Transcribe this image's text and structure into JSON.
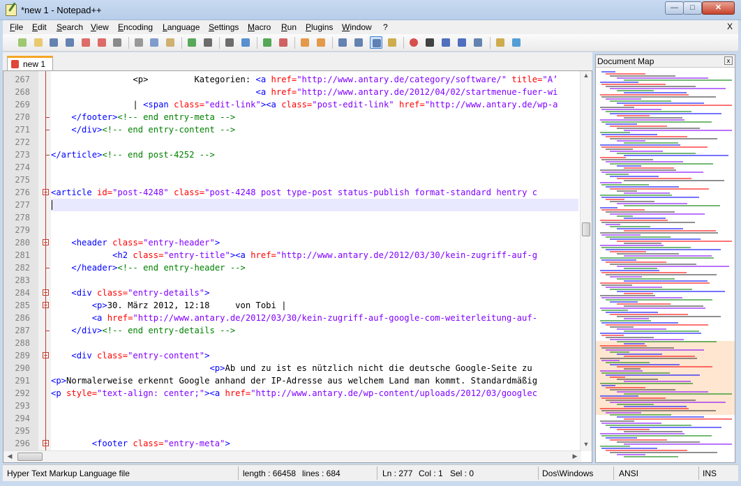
{
  "window": {
    "title": "*new  1 - Notepad++",
    "close_doc_label": "X"
  },
  "menu": [
    "File",
    "Edit",
    "Search",
    "View",
    "Encoding",
    "Language",
    "Settings",
    "Macro",
    "Run",
    "Plugins",
    "Window",
    "?"
  ],
  "tab": {
    "label": "new  1"
  },
  "editor": {
    "lines": [
      {
        "num": "267",
        "fold": "none",
        "tokens": [
          [
            "txt",
            "                <p>         Kategorien: "
          ],
          [
            "tag",
            "<a "
          ],
          [
            "attr",
            "href="
          ],
          [
            "str",
            "\"http://www.antary.de/category/software/\""
          ],
          [
            "attr",
            " title="
          ],
          [
            "str",
            "\"A’"
          ]
        ]
      },
      {
        "num": "268",
        "fold": "none",
        "tokens": [
          [
            "txt",
            "                                        "
          ],
          [
            "tag",
            "<a "
          ],
          [
            "attr",
            "href="
          ],
          [
            "str",
            "\"http://www.antary.de/2012/04/02/startmenue-fuer-wi"
          ]
        ]
      },
      {
        "num": "269",
        "fold": "none",
        "tokens": [
          [
            "txt",
            "                | "
          ],
          [
            "tag",
            "<span "
          ],
          [
            "attr",
            "class="
          ],
          [
            "str",
            "\"edit-link\""
          ],
          [
            "tag",
            "><a "
          ],
          [
            "attr",
            "class="
          ],
          [
            "str",
            "\"post-edit-link\""
          ],
          [
            "attr",
            " href="
          ],
          [
            "str",
            "\"http://www.antary.de/wp-a"
          ]
        ]
      },
      {
        "num": "270",
        "fold": "end",
        "tokens": [
          [
            "txt",
            "    "
          ],
          [
            "tag",
            "</footer>"
          ],
          [
            "com",
            "<!-- end entry-meta -->"
          ]
        ]
      },
      {
        "num": "271",
        "fold": "end",
        "tokens": [
          [
            "txt",
            "    "
          ],
          [
            "tag",
            "</div>"
          ],
          [
            "com",
            "<!-- end entry-content -->"
          ]
        ]
      },
      {
        "num": "272",
        "fold": "none",
        "tokens": [
          [
            "txt",
            ""
          ]
        ]
      },
      {
        "num": "273",
        "fold": "end",
        "tokens": [
          [
            "tag",
            "</article>"
          ],
          [
            "com",
            "<!-- end post-4252 -->"
          ]
        ]
      },
      {
        "num": "274",
        "fold": "none",
        "tokens": [
          [
            "txt",
            ""
          ]
        ]
      },
      {
        "num": "275",
        "fold": "none",
        "tokens": [
          [
            "txt",
            ""
          ]
        ]
      },
      {
        "num": "276",
        "fold": "open",
        "tokens": [
          [
            "tag",
            "<article "
          ],
          [
            "attr",
            "id="
          ],
          [
            "str",
            "\"post-4248\""
          ],
          [
            "attr",
            " class="
          ],
          [
            "str",
            "\"post-4248 post type-post status-publish format-standard hentry c"
          ]
        ]
      },
      {
        "num": "277",
        "fold": "none",
        "current": true,
        "tokens": [
          [
            "txt",
            ""
          ]
        ]
      },
      {
        "num": "278",
        "fold": "none",
        "tokens": [
          [
            "txt",
            ""
          ]
        ]
      },
      {
        "num": "279",
        "fold": "none",
        "tokens": [
          [
            "txt",
            ""
          ]
        ]
      },
      {
        "num": "280",
        "fold": "open",
        "tokens": [
          [
            "txt",
            "    "
          ],
          [
            "tag",
            "<header "
          ],
          [
            "attr",
            "class="
          ],
          [
            "str",
            "\"entry-header\""
          ],
          [
            "tag",
            ">"
          ]
        ]
      },
      {
        "num": "281",
        "fold": "none",
        "tokens": [
          [
            "txt",
            "            "
          ],
          [
            "tag",
            "<h2 "
          ],
          [
            "attr",
            "class="
          ],
          [
            "str",
            "\"entry-title\""
          ],
          [
            "tag",
            "><a "
          ],
          [
            "attr",
            "href="
          ],
          [
            "str",
            "\"http://www.antary.de/2012/03/30/kein-zugriff-auf-g"
          ]
        ]
      },
      {
        "num": "282",
        "fold": "end",
        "tokens": [
          [
            "txt",
            "    "
          ],
          [
            "tag",
            "</header>"
          ],
          [
            "com",
            "<!-- end entry-header -->"
          ]
        ]
      },
      {
        "num": "283",
        "fold": "none",
        "tokens": [
          [
            "txt",
            ""
          ]
        ]
      },
      {
        "num": "284",
        "fold": "open",
        "tokens": [
          [
            "txt",
            "    "
          ],
          [
            "tag",
            "<div "
          ],
          [
            "attr",
            "class="
          ],
          [
            "str",
            "\"entry-details\""
          ],
          [
            "tag",
            ">"
          ]
        ]
      },
      {
        "num": "285",
        "fold": "open",
        "tokens": [
          [
            "txt",
            "        "
          ],
          [
            "tag",
            "<p>"
          ],
          [
            "txt",
            "30. März 2012, 12:18     von Tobi |"
          ]
        ]
      },
      {
        "num": "286",
        "fold": "none",
        "tokens": [
          [
            "txt",
            "        "
          ],
          [
            "tag",
            "<a "
          ],
          [
            "attr",
            "href="
          ],
          [
            "str",
            "\"http://www.antary.de/2012/03/30/kein-zugriff-auf-google-com-weiterleitung-auf-"
          ]
        ]
      },
      {
        "num": "287",
        "fold": "end",
        "tokens": [
          [
            "txt",
            "    "
          ],
          [
            "tag",
            "</div>"
          ],
          [
            "com",
            "<!-- end entry-details -->"
          ]
        ]
      },
      {
        "num": "288",
        "fold": "none",
        "tokens": [
          [
            "txt",
            ""
          ]
        ]
      },
      {
        "num": "289",
        "fold": "open",
        "tokens": [
          [
            "txt",
            "    "
          ],
          [
            "tag",
            "<div "
          ],
          [
            "attr",
            "class="
          ],
          [
            "str",
            "\"entry-content\""
          ],
          [
            "tag",
            ">"
          ]
        ]
      },
      {
        "num": "290",
        "fold": "none",
        "tokens": [
          [
            "txt",
            "                               "
          ],
          [
            "tag",
            "<p>"
          ],
          [
            "txt",
            "Ab und zu ist es nützlich nicht die deutsche Google-Seite zu"
          ]
        ]
      },
      {
        "num": "291",
        "fold": "none",
        "tokens": [
          [
            "tag",
            "<p>"
          ],
          [
            "txt",
            "Normalerweise erkennt Google anhand der IP-Adresse aus welchem Land man kommt. Standardmäßig"
          ]
        ]
      },
      {
        "num": "292",
        "fold": "none",
        "tokens": [
          [
            "tag",
            "<p "
          ],
          [
            "attr",
            "style="
          ],
          [
            "str",
            "\"text-align: center;\""
          ],
          [
            "tag",
            "><a "
          ],
          [
            "attr",
            "href="
          ],
          [
            "str",
            "\"http://www.antary.de/wp-content/uploads/2012/03/googlec"
          ]
        ]
      },
      {
        "num": "293",
        "fold": "none",
        "tokens": [
          [
            "txt",
            ""
          ]
        ]
      },
      {
        "num": "294",
        "fold": "none",
        "tokens": [
          [
            "txt",
            ""
          ]
        ]
      },
      {
        "num": "295",
        "fold": "none",
        "tokens": [
          [
            "txt",
            ""
          ]
        ]
      },
      {
        "num": "296",
        "fold": "open",
        "tokens": [
          [
            "txt",
            "        "
          ],
          [
            "tag",
            "<footer "
          ],
          [
            "attr",
            "class="
          ],
          [
            "str",
            "\"entry-meta\""
          ],
          [
            "tag",
            ">"
          ]
        ]
      }
    ]
  },
  "docmap": {
    "title": "Document Map",
    "close_label": "x"
  },
  "status": {
    "file_type": "Hyper Text Markup Language file",
    "length": "length : 66458",
    "lines": "lines : 684",
    "ln": "Ln : 277",
    "col": "Col : 1",
    "sel": "Sel : 0",
    "eol": "Dos\\Windows",
    "encoding": "ANSI",
    "mode": "INS"
  },
  "toolbar_icons": [
    "new-file-icon",
    "open-file-icon",
    "save-icon",
    "save-all-icon",
    "close-icon",
    "close-all-icon",
    "print-icon",
    "cut-icon",
    "copy-icon",
    "paste-icon",
    "undo-icon",
    "redo-icon",
    "find-icon",
    "replace-icon",
    "zoom-in-icon",
    "zoom-out-icon",
    "sync-vertical-icon",
    "sync-horizontal-icon",
    "word-wrap-icon",
    "show-all-chars-icon",
    "indent-guide-icon",
    "document-map-icon",
    "record-macro-icon",
    "stop-macro-icon",
    "play-macro-icon",
    "run-macro-multiple-icon",
    "save-macro-icon",
    "function-list-icon",
    "spell-check-icon"
  ],
  "colors": {
    "tag": "#0000ff",
    "attr": "#ff0000",
    "string": "#8000ff",
    "comment": "#008000",
    "current_line": "#e8e8ff",
    "tab_accent": "#f5a623"
  }
}
